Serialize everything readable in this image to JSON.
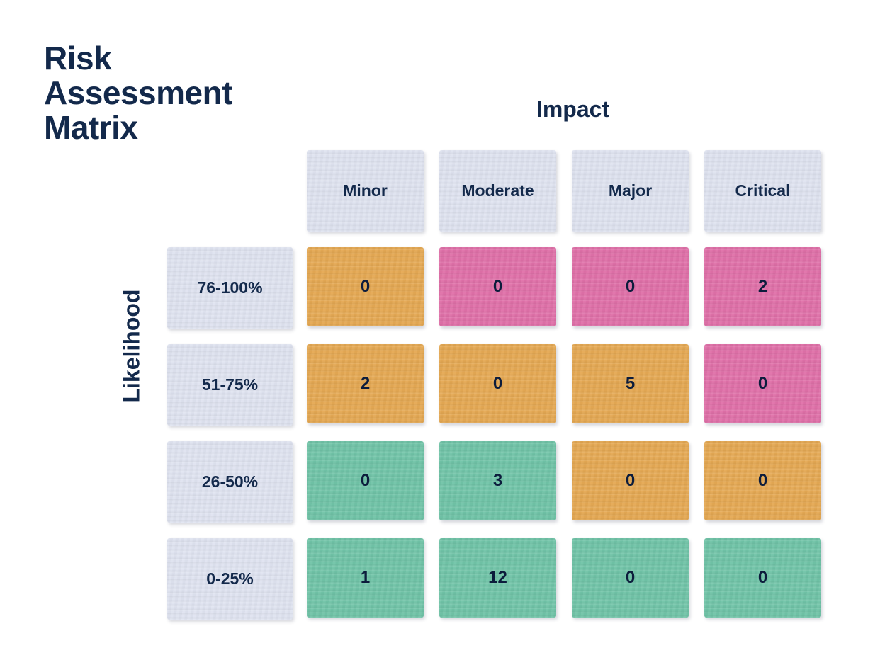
{
  "title": "Risk\nAssessment\nMatrix",
  "axes": {
    "x_title": "Impact",
    "y_title": "Likelihood"
  },
  "colors": {
    "text": "#13294B",
    "cell_text": "#0C1C3C",
    "label_bg": "#DFE3F0",
    "low": "#71C4A8",
    "medium": "#E5A954",
    "high": "#E071A9",
    "page_bg": "#FFFFFF"
  },
  "chart_data": {
    "type": "heatmap",
    "title": "Risk Assessment Matrix",
    "xlabel": "Impact",
    "ylabel": "Likelihood",
    "categories": [
      "Minor",
      "Moderate",
      "Major",
      "Critical"
    ],
    "rows": [
      "76-100%",
      "51-75%",
      "26-50%",
      "0-25%"
    ],
    "grid": false,
    "legend": "none",
    "cells": [
      [
        {
          "value": "0",
          "level": "medium",
          "color": "#E5A954"
        },
        {
          "value": "0",
          "level": "high",
          "color": "#E071A9"
        },
        {
          "value": "0",
          "level": "high",
          "color": "#E071A9"
        },
        {
          "value": "2",
          "level": "high",
          "color": "#E071A9"
        }
      ],
      [
        {
          "value": "2",
          "level": "medium",
          "color": "#E5A954"
        },
        {
          "value": "0",
          "level": "medium",
          "color": "#E5A954"
        },
        {
          "value": "5",
          "level": "medium",
          "color": "#E5A954"
        },
        {
          "value": "0",
          "level": "high",
          "color": "#E071A9"
        }
      ],
      [
        {
          "value": "0",
          "level": "low",
          "color": "#71C4A8"
        },
        {
          "value": "3",
          "level": "low",
          "color": "#71C4A8"
        },
        {
          "value": "0",
          "level": "medium",
          "color": "#E5A954"
        },
        {
          "value": "0",
          "level": "medium",
          "color": "#E5A954"
        }
      ],
      [
        {
          "value": "1",
          "level": "low",
          "color": "#71C4A8"
        },
        {
          "value": "12",
          "level": "low",
          "color": "#71C4A8"
        },
        {
          "value": "0",
          "level": "low",
          "color": "#71C4A8"
        },
        {
          "value": "0",
          "level": "low",
          "color": "#71C4A8"
        }
      ]
    ]
  }
}
